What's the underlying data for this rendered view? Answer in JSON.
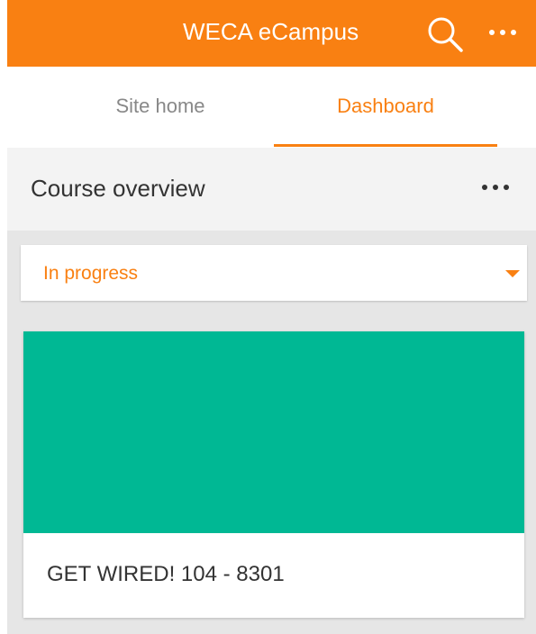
{
  "app": {
    "title": "WECA eCampus",
    "accent_color": "#f98012",
    "icons": [
      "search-icon",
      "more-options-icon"
    ]
  },
  "tabs": [
    {
      "label": "Site home",
      "active": false
    },
    {
      "label": "Dashboard",
      "active": true
    }
  ],
  "course_overview": {
    "title": "Course overview",
    "more_icon": "more-options-icon",
    "filter": {
      "selected": "In progress",
      "caret_icon": "caret-down-icon"
    },
    "courses": [
      {
        "name": "GET WIRED! 104 - 8301",
        "image_color": "#00b894"
      }
    ]
  }
}
